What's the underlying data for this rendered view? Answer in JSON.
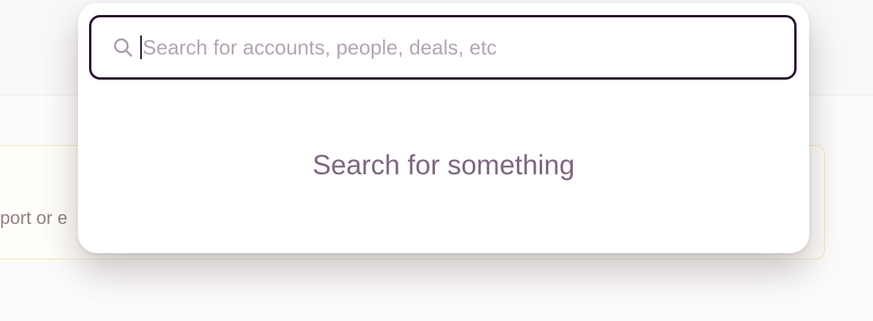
{
  "background": {
    "banner_text": "port or e"
  },
  "search": {
    "placeholder": "Search for accounts, people, deals, etc",
    "value": "",
    "icon": "search-icon"
  },
  "empty_state": {
    "message": "Search for something"
  },
  "colors": {
    "border": "#2b1330",
    "placeholder": "#b5a4b4",
    "message": "#7e6681",
    "banner_border": "#f0d98e"
  }
}
